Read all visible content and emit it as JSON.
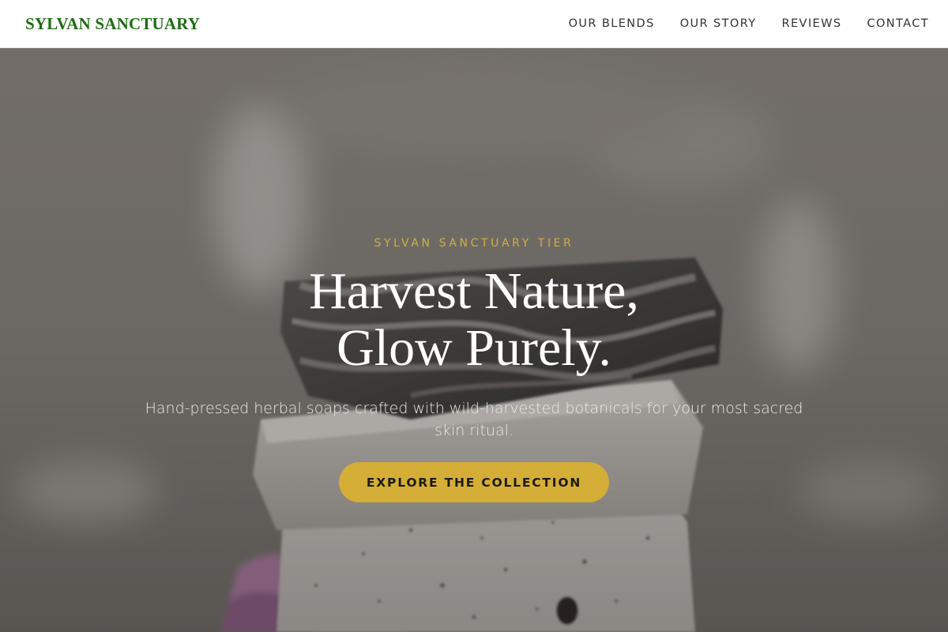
{
  "header": {
    "brand": "SYLVAN SANCTUARY",
    "nav": [
      {
        "label": "OUR BLENDS"
      },
      {
        "label": "OUR STORY"
      },
      {
        "label": "REVIEWS"
      },
      {
        "label": "CONTACT"
      }
    ]
  },
  "hero": {
    "tier_label": "SYLVAN SANCTUARY TIER",
    "title_line1": "Harvest Nature,",
    "title_line2": "Glow Purely.",
    "subtitle": "Hand-pressed herbal soaps crafted with wild-harvested botanicals for your most sacred skin ritual.",
    "cta_label": "EXPLORE THE COLLECTION",
    "background_icon": "stacked-soap-bars-photo"
  },
  "colors": {
    "brand": "#1d6b12",
    "accent_gold": "#d4ae36",
    "tier_gold": "#d2ae43",
    "nav_text": "#333333"
  }
}
